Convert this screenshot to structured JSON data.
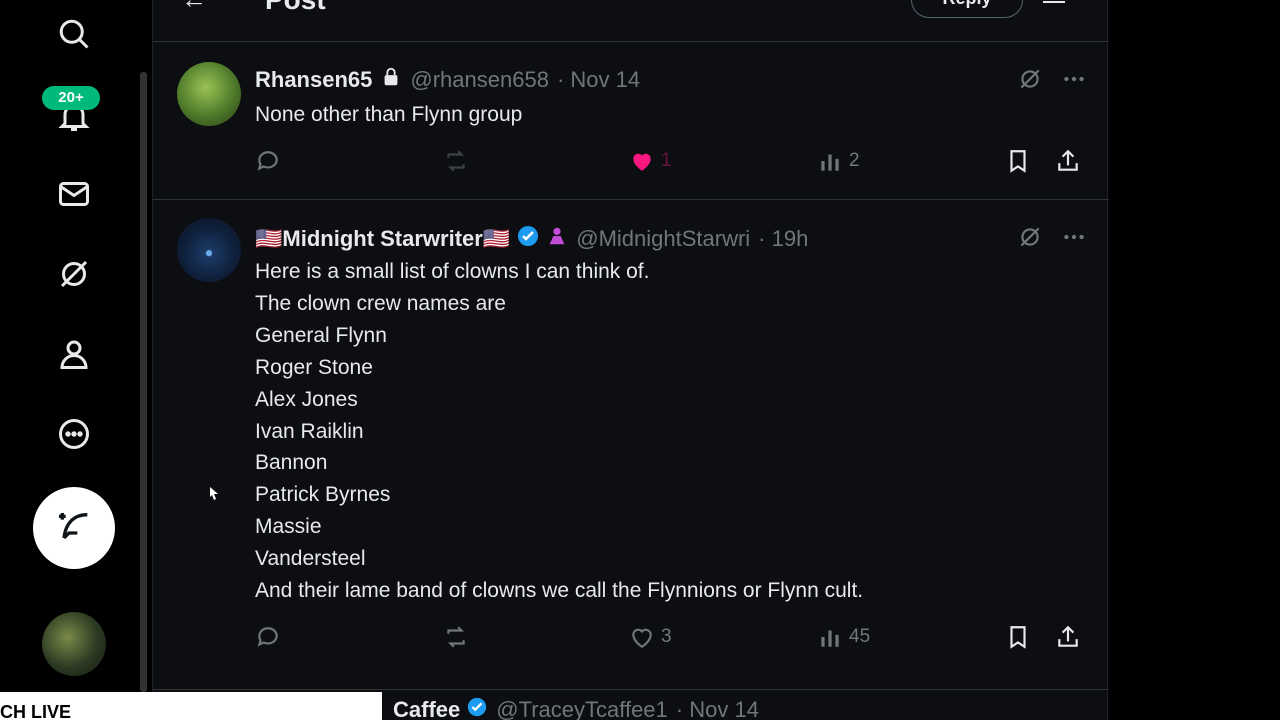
{
  "header": {
    "back_icon": "arrow-left-icon",
    "title": "Post",
    "reply_label": "Reply"
  },
  "nav": {
    "items": [
      {
        "icon": "search-icon"
      },
      {
        "icon": "bell-icon",
        "badge": "20+"
      },
      {
        "icon": "mail-icon"
      },
      {
        "icon": "grok-icon"
      },
      {
        "icon": "person-icon"
      },
      {
        "icon": "more-circle-icon"
      }
    ],
    "compose_icon": "feather-icon"
  },
  "tweets": [
    {
      "name": "Rhansen65",
      "handle": "@rhansen658",
      "time": "· Nov 14",
      "text": "None other than Flynn group",
      "likes": "1",
      "views": "2"
    },
    {
      "name": "🇺🇸Midnight Starwriter🇺🇸",
      "handle": "@MidnightStarwri",
      "time": "· 19h",
      "text": "Here is a small list of clowns I can think of.\nThe clown crew names are\nGeneral Flynn\nRoger Stone\nAlex Jones\nIvan Raiklin\nBannon\nPatrick Byrnes\nMassie\nVandersteel\nAnd their lame band of clowns we call the Flynnions or Flynn cult.",
      "likes": "3",
      "views": "45"
    },
    {
      "name": "Caffee",
      "handle": "@TraceyTcaffee1",
      "time": "· Nov 14"
    }
  ],
  "banner": {
    "text": "CH LIVE"
  },
  "colors": {
    "background": "#0c0e12",
    "accent_blue": "#1d9bf0",
    "like_pink": "#f91880",
    "badge_green": "#00ba7c",
    "muted": "#71767b"
  }
}
